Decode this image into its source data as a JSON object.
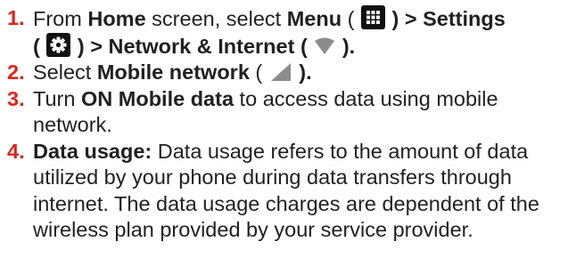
{
  "steps": [
    {
      "number": "1.",
      "from": "From ",
      "home": "Home",
      "screen_select": " screen, select ",
      "menu": "Menu",
      "paren_open_1": " ( ",
      "menu_icon": "menu-grid-icon",
      "paren_close_settings": " ) > Settings",
      "paren_open_2": "( ",
      "settings_icon": "gear-icon",
      "paren_close_network": " ) > Network & Internet ( ",
      "wifi_icon": "wifi-icon",
      "end": " )."
    },
    {
      "number": "2.",
      "select": "Select ",
      "mobile_network": "Mobile network",
      "paren_open": " ( ",
      "signal_icon": "cellular-signal-icon",
      "end": " )."
    },
    {
      "number": "3.",
      "turn": "Turn ",
      "on_mobile_data": "ON Mobile data",
      "rest": " to access data using mobile network."
    },
    {
      "number": "4.",
      "data_usage_label": "Data usage:",
      "text": " Data usage refers to the amount of data utilized by your phone during data transfers through internet. The data usage charges are dependent of the wireless plan provided by your service provider."
    }
  ],
  "colors": {
    "step_number": "#e2231a",
    "text": "#231f20",
    "icon_box": "#111111"
  }
}
